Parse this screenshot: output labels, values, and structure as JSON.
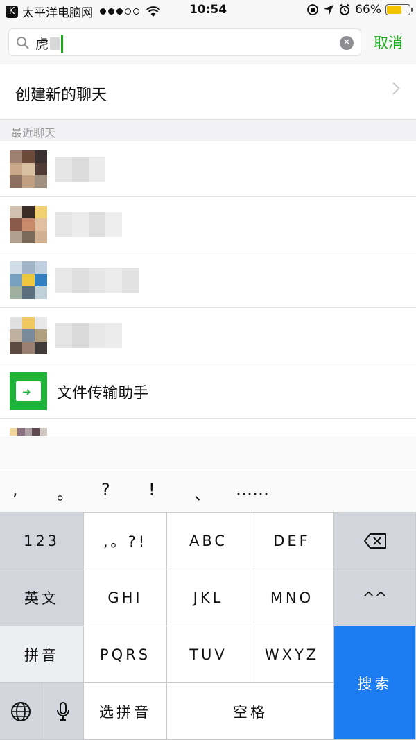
{
  "status_bar": {
    "back_badge": "K",
    "carrier": "太平洋电脑网",
    "time": "10:54",
    "battery_percent": "66%",
    "battery_level": 0.66,
    "battery_color": "#f5c400"
  },
  "search": {
    "query": "虎",
    "cancel_label": "取消",
    "clear_glyph": "✕",
    "accent_color": "#1aad19"
  },
  "create_chat": {
    "label": "创建新的聊天"
  },
  "recent": {
    "section_label": "最近聊天",
    "file_helper_name": "文件传输助手",
    "file_helper_arrow": "➜"
  },
  "keyboard": {
    "punctuation": [
      ",",
      "。",
      "?",
      "!",
      "、",
      "……"
    ],
    "keys": {
      "num": "123",
      "punct": ",。?!",
      "abc": "ABC",
      "def": "DEF",
      "english": "英文",
      "ghi": "GHI",
      "jkl": "JKL",
      "mno": "MNO",
      "emoticon": "^^",
      "pinyin": "拼音",
      "pqrs": "PQRS",
      "tuv": "TUV",
      "wxyz": "WXYZ",
      "search": "搜索",
      "select_pinyin": "选拼音",
      "space": "空格"
    },
    "search_key_color": "#1b7cf2"
  }
}
